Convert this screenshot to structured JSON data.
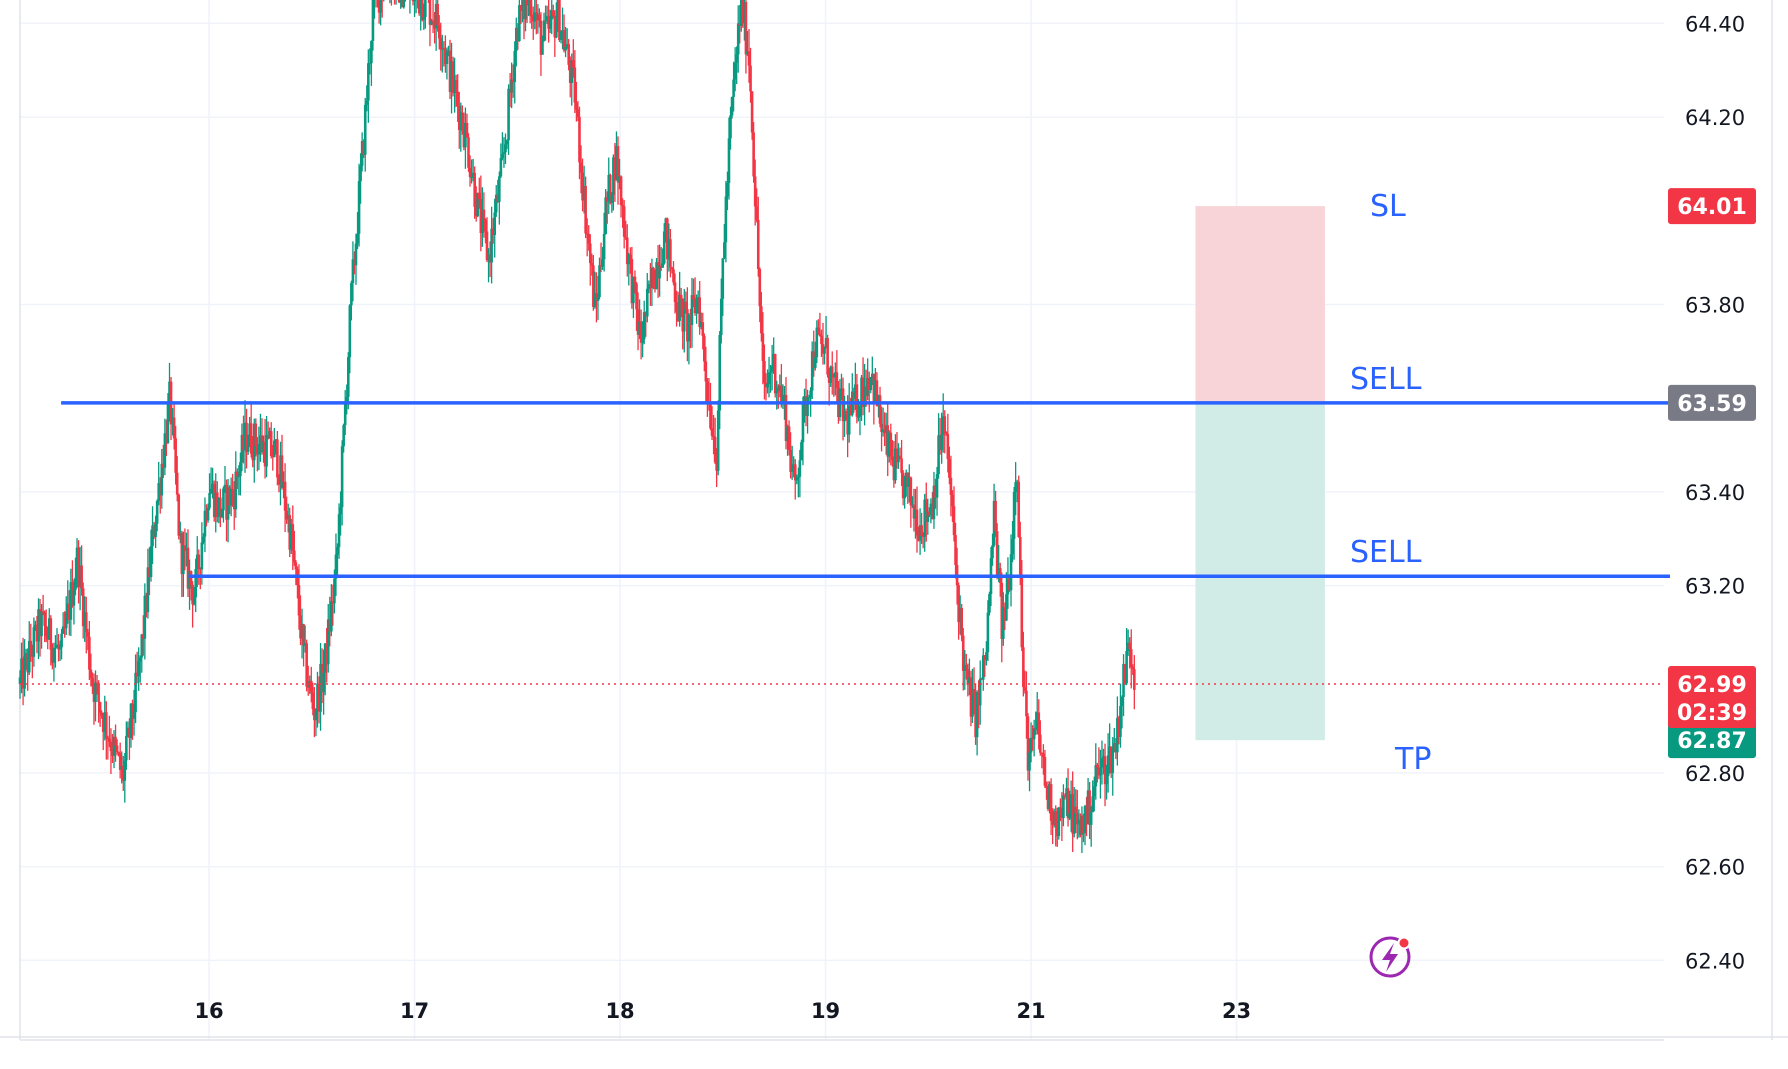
{
  "chart_data": {
    "type": "candlestick",
    "grid": true,
    "y_axis": {
      "position": "right",
      "ticks": [
        "64.40",
        "64.20",
        "63.80",
        "63.40",
        "63.20",
        "62.80",
        "62.60",
        "62.40"
      ],
      "range": [
        62.23,
        64.45
      ]
    },
    "x_axis": {
      "ticks": [
        "16",
        "17",
        "18",
        "19",
        "21",
        "23"
      ],
      "range": [
        15.08,
        23.08
      ]
    },
    "price_path": [
      [
        15.08,
        62.99
      ],
      [
        15.18,
        63.12
      ],
      [
        15.28,
        63.05
      ],
      [
        15.36,
        63.26
      ],
      [
        15.43,
        63.0
      ],
      [
        15.5,
        62.9
      ],
      [
        15.58,
        62.79
      ],
      [
        15.66,
        63.02
      ],
      [
        15.73,
        63.32
      ],
      [
        15.81,
        63.6
      ],
      [
        15.86,
        63.28
      ],
      [
        15.93,
        63.18
      ],
      [
        16.0,
        63.42
      ],
      [
        16.05,
        63.36
      ],
      [
        16.12,
        63.4
      ],
      [
        16.18,
        63.52
      ],
      [
        16.26,
        63.5
      ],
      [
        16.33,
        63.48
      ],
      [
        16.4,
        63.3
      ],
      [
        16.46,
        63.05
      ],
      [
        16.51,
        62.93
      ],
      [
        16.56,
        63.02
      ],
      [
        16.62,
        63.24
      ],
      [
        16.69,
        63.8
      ],
      [
        16.76,
        64.2
      ],
      [
        16.8,
        64.45
      ],
      [
        16.88,
        64.5
      ],
      [
        16.95,
        64.47
      ],
      [
        17.05,
        64.45
      ],
      [
        17.12,
        64.4
      ],
      [
        17.18,
        64.28
      ],
      [
        17.25,
        64.16
      ],
      [
        17.31,
        64.0
      ],
      [
        17.36,
        63.9
      ],
      [
        17.43,
        64.1
      ],
      [
        17.5,
        64.4
      ],
      [
        17.56,
        64.46
      ],
      [
        17.62,
        64.36
      ],
      [
        17.7,
        64.42
      ],
      [
        17.78,
        64.25
      ],
      [
        17.83,
        64.0
      ],
      [
        17.88,
        63.78
      ],
      [
        17.93,
        64.0
      ],
      [
        17.98,
        64.12
      ],
      [
        18.04,
        63.9
      ],
      [
        18.1,
        63.72
      ],
      [
        18.16,
        63.86
      ],
      [
        18.22,
        63.95
      ],
      [
        18.28,
        63.8
      ],
      [
        18.33,
        63.75
      ],
      [
        18.38,
        63.82
      ],
      [
        18.43,
        63.6
      ],
      [
        18.47,
        63.48
      ],
      [
        18.5,
        63.9
      ],
      [
        18.54,
        64.2
      ],
      [
        18.59,
        64.45
      ],
      [
        18.63,
        64.32
      ],
      [
        18.67,
        63.9
      ],
      [
        18.7,
        63.6
      ],
      [
        18.74,
        63.68
      ],
      [
        18.8,
        63.58
      ],
      [
        18.85,
        63.4
      ],
      [
        18.89,
        63.55
      ],
      [
        18.95,
        63.72
      ],
      [
        19.0,
        63.7
      ],
      [
        19.04,
        63.62
      ],
      [
        19.1,
        63.55
      ],
      [
        19.16,
        63.6
      ],
      [
        19.22,
        63.66
      ],
      [
        19.28,
        63.52
      ],
      [
        19.34,
        63.45
      ],
      [
        19.4,
        63.4
      ],
      [
        19.46,
        63.33
      ],
      [
        19.52,
        63.38
      ],
      [
        19.57,
        63.55
      ],
      [
        19.6,
        63.45
      ],
      [
        19.64,
        63.2
      ],
      [
        19.68,
        63.0
      ],
      [
        19.73,
        62.92
      ],
      [
        19.78,
        63.05
      ],
      [
        19.82,
        63.35
      ],
      [
        19.86,
        63.1
      ],
      [
        19.9,
        63.25
      ],
      [
        19.93,
        63.5
      ],
      [
        19.96,
        63.0
      ],
      [
        19.99,
        62.82
      ],
      [
        20.03,
        62.9
      ],
      [
        20.08,
        62.75
      ],
      [
        20.13,
        62.7
      ],
      [
        20.18,
        62.74
      ],
      [
        20.23,
        62.68
      ],
      [
        20.28,
        62.72
      ],
      [
        20.32,
        62.8
      ],
      [
        20.37,
        62.82
      ],
      [
        20.41,
        62.86
      ],
      [
        20.45,
        63.0
      ],
      [
        20.48,
        63.08
      ],
      [
        20.51,
        62.99
      ]
    ],
    "levels": [
      {
        "label": "SELL",
        "price": 63.59,
        "from": 15.28
      },
      {
        "label": "SELL",
        "price": 63.22,
        "from": 15.9
      }
    ],
    "position": {
      "direction": "short",
      "entry": 63.59,
      "stop_loss": 64.01,
      "take_profit": 62.87,
      "entry_label": "SELL",
      "sl_label": "SL",
      "tp_label": "TP",
      "from": 20.8,
      "to": 21.43,
      "loss_color": "#f8d3d7",
      "profit_color": "#d1ece7"
    },
    "current_price": {
      "value": 62.99,
      "text": "62.99",
      "countdown": "02:39",
      "color": "#f23645"
    },
    "price_tags": [
      {
        "value": 64.01,
        "text": "64.01",
        "color": "#f23645"
      },
      {
        "value": 63.59,
        "text": "63.59",
        "color": "#787b86"
      },
      {
        "value": 62.87,
        "text": "62.87",
        "color": "#089981"
      }
    ],
    "colors": {
      "up": "#089981",
      "down": "#f23645",
      "level_line": "#2962ff",
      "annotation": "#2962ff",
      "grid": "#f0f3fa",
      "icon": "#9c27b0"
    },
    "icons": [
      "lightning-badge-icon"
    ]
  }
}
